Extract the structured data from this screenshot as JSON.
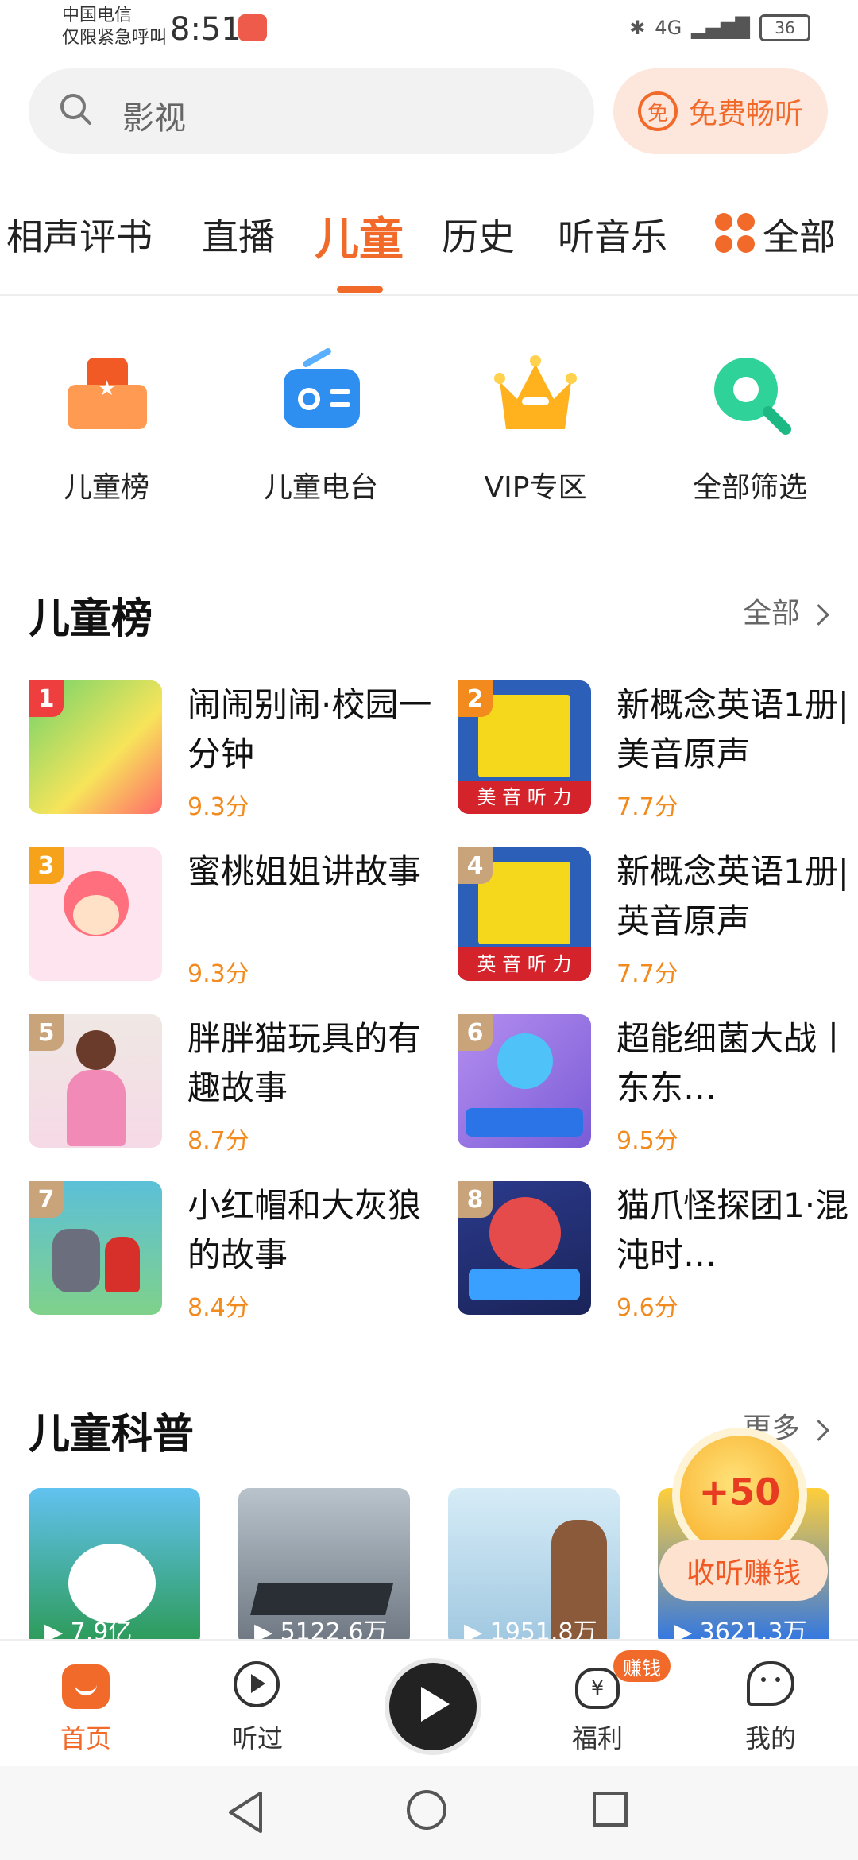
{
  "status_bar": {
    "carrier_line1": "中国电信",
    "carrier_line2": "仅限紧急呼叫",
    "time": "8:51",
    "network": "4G",
    "battery": "36"
  },
  "search": {
    "placeholder": "影视"
  },
  "free_listen": {
    "icon_text": "免",
    "label": "免费畅听"
  },
  "tabs": [
    "相声评书",
    "直播",
    "儿童",
    "历史",
    "听音乐",
    "全部"
  ],
  "active_tab": "儿童",
  "shortcuts": [
    {
      "label": "儿童榜",
      "icon": "ranking-icon"
    },
    {
      "label": "儿童电台",
      "icon": "radio-icon"
    },
    {
      "label": "VIP专区",
      "icon": "crown-icon"
    },
    {
      "label": "全部筛选",
      "icon": "filter-search-icon"
    }
  ],
  "kids_rank": {
    "title": "儿童榜",
    "more": "全部",
    "items": [
      {
        "rank": "1",
        "title": "闹闹别闹·校园一分钟",
        "score": "9.3分"
      },
      {
        "rank": "2",
        "title": "新概念英语1册|美音原声",
        "score": "7.7分",
        "cover_caption": "美 音 听 力"
      },
      {
        "rank": "3",
        "title": "蜜桃姐姐讲故事",
        "score": "9.3分"
      },
      {
        "rank": "4",
        "title": "新概念英语1册|英音原声",
        "score": "7.7分",
        "cover_caption": "英 音 听 力"
      },
      {
        "rank": "5",
        "title": "胖胖猫玩具的有趣故事",
        "score": "8.7分"
      },
      {
        "rank": "6",
        "title": "超能细菌大战丨东东…",
        "score": "9.5分"
      },
      {
        "rank": "7",
        "title": "小红帽和大灰狼的故事",
        "score": "8.4分"
      },
      {
        "rank": "8",
        "title": "猫爪怪探团1·混沌时…",
        "score": "9.6分"
      }
    ]
  },
  "kids_science": {
    "title": "儿童科普",
    "more": "更多",
    "items": [
      {
        "plays": "7.9亿"
      },
      {
        "plays": "5122.6万"
      },
      {
        "plays": "1951.8万"
      },
      {
        "plays": "3621.3万"
      }
    ]
  },
  "reward": {
    "amount": "+50",
    "label": "收听赚钱"
  },
  "bottom_nav": [
    {
      "label": "首页",
      "icon": "home-icon"
    },
    {
      "label": "听过",
      "icon": "history-play-icon"
    },
    {
      "label": "福利",
      "icon": "money-bag-icon"
    },
    {
      "label": "我的",
      "icon": "profile-icon"
    }
  ],
  "earn_badge": "赚钱",
  "colors": {
    "accent": "#f26a2a",
    "score": "#f28a1e"
  }
}
